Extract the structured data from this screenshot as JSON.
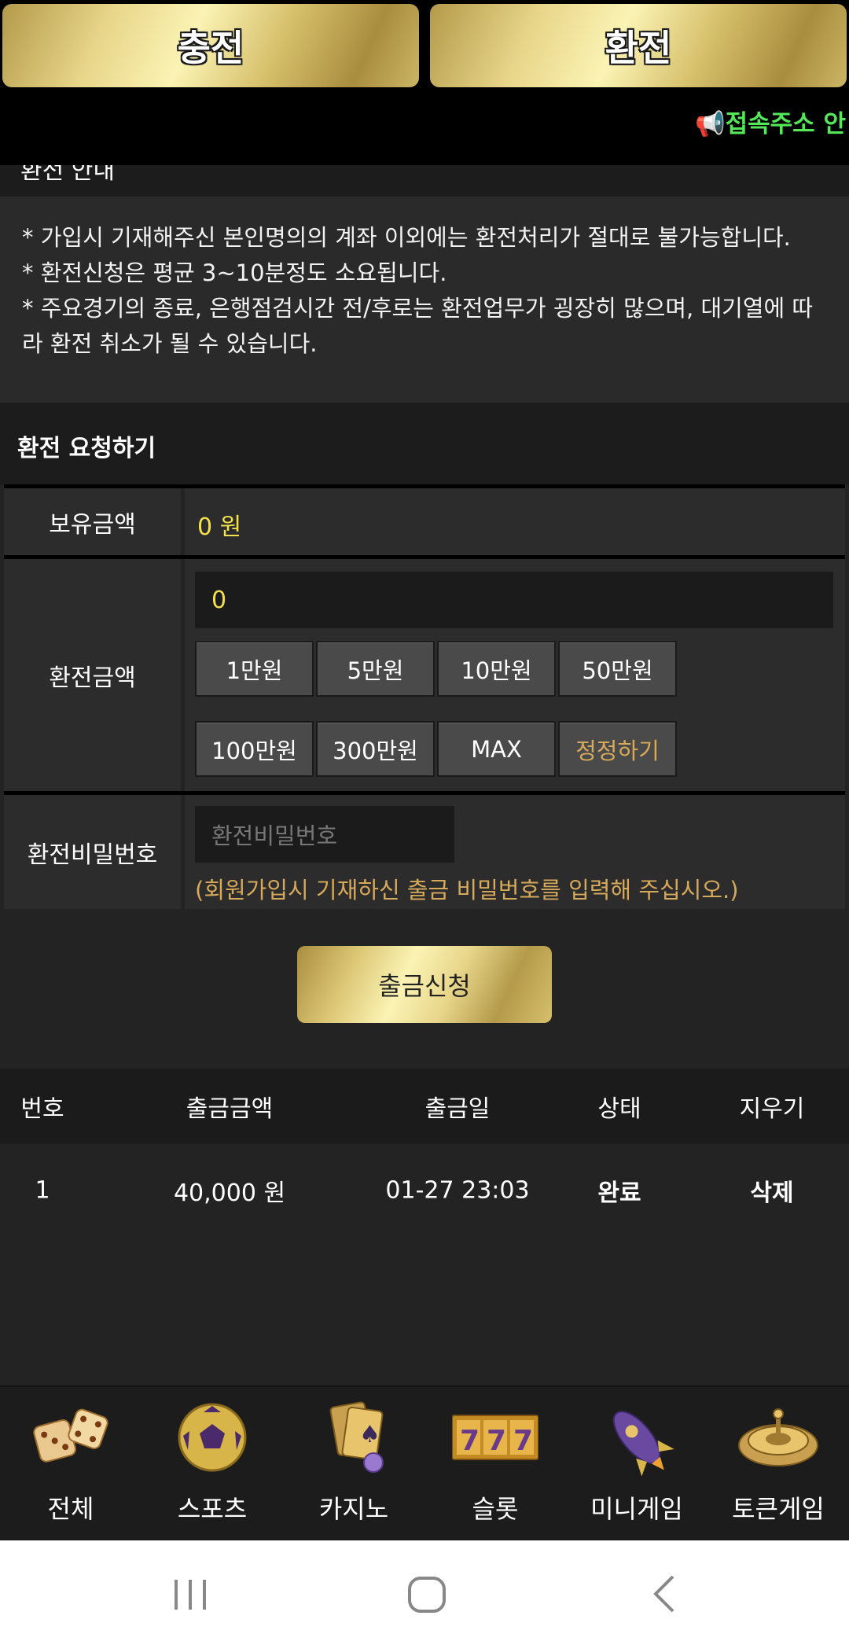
{
  "top_tabs": {
    "charge": "충전",
    "exchange": "환전"
  },
  "ticker": {
    "text": "📢접속주소 안"
  },
  "cut_section_title": "환전 안내",
  "notice": [
    "* 가입시 기재해주신 본인명의의 계좌 이외에는 환전처리가 절대로 불가능합니다.",
    "* 환전신청은 평균 3~10분정도 소요됩니다.",
    "* 주요경기의 종료, 은행점검시간 전/후로는 환전업무가 굉장히 많으며, 대기열에 따라 환전 취소가 될 수 있습니다."
  ],
  "request_title": "환전 요청하기",
  "form": {
    "balance_label": "보유금액",
    "balance_value": "0 원",
    "amount_label": "환전금액",
    "amount_value": "0",
    "chips": [
      "1만원",
      "5만원",
      "10만원",
      "50만원",
      "100만원",
      "300만원",
      "MAX",
      "정정하기"
    ],
    "password_label": "환전비밀번호",
    "password_placeholder": "환전비밀번호",
    "password_hint": "(회원가입시 기재하신 출금 비밀번호를 입력해 주십시오.)"
  },
  "submit_label": "출금신청",
  "history": {
    "headers": [
      "번호",
      "출금금액",
      "출금일",
      "상태",
      "지우기"
    ],
    "rows": [
      {
        "no": "1",
        "amount": "40,000 원",
        "date": "01-27 23:03",
        "status": "완료",
        "action": "삭제"
      }
    ]
  },
  "bottom_nav": [
    {
      "label": "전체",
      "icon": "dice-icon"
    },
    {
      "label": "스포츠",
      "icon": "soccer-ball-icon"
    },
    {
      "label": "카지노",
      "icon": "playing-cards-icon"
    },
    {
      "label": "슬롯",
      "icon": "slot-777-icon"
    },
    {
      "label": "미니게임",
      "icon": "rocket-icon"
    },
    {
      "label": "토큰게임",
      "icon": "roulette-icon"
    }
  ],
  "system_nav": [
    "recent-apps-icon",
    "home-icon",
    "back-icon"
  ]
}
